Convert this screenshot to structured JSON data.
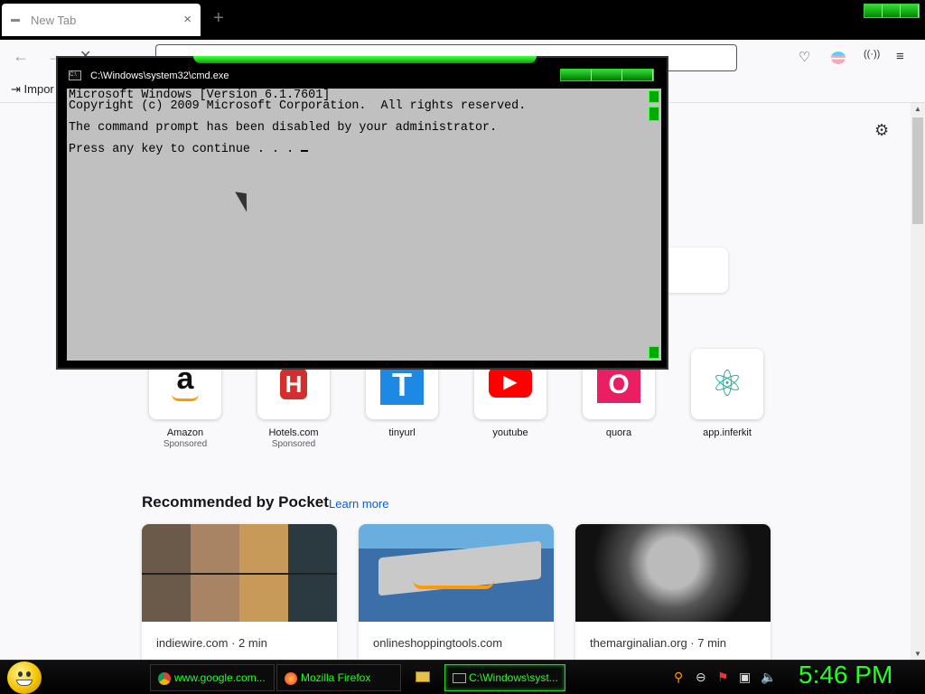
{
  "browser": {
    "tab_title": "New Tab",
    "tab_close": "×",
    "new_tab": "+",
    "back": "←",
    "forward": "→",
    "stop": "✕",
    "bookmark_import": "Impor",
    "settings_icon": "gear-icon"
  },
  "shortcuts": [
    {
      "name": "Amazon",
      "sponsored": "Sponsored",
      "glyph": "a",
      "color": "#ffffff"
    },
    {
      "name": "Hotels.com",
      "sponsored": "Sponsored",
      "glyph": "H",
      "color": "#d32f2f"
    },
    {
      "name": "tinyurl",
      "sponsored": "",
      "glyph": "T",
      "color": "#1e88e5"
    },
    {
      "name": "youtube",
      "sponsored": "",
      "glyph": "▶",
      "color": "#ff0000"
    },
    {
      "name": "quora",
      "sponsored": "",
      "glyph": "O",
      "color": "#e91e63"
    },
    {
      "name": "app.inferkit",
      "sponsored": "",
      "glyph": "⚛",
      "color": "#26a69a"
    }
  ],
  "pocket": {
    "heading": "Recommended by Pocket",
    "learn_more": "Learn more",
    "cards": [
      {
        "source": "indiewire.com · 2 min"
      },
      {
        "source": "onlineshoppingtools.com"
      },
      {
        "source": "themarginalian.org · 7 min"
      }
    ]
  },
  "cmd": {
    "title": "C:\\Windows\\system32\\cmd.exe",
    "icon_text": "C:\\",
    "line1": "Microsoft Windows [Version 6.1.7601]",
    "line2": "Copyright (c) 2009 Microsoft Corporation.  All rights reserved.",
    "line3": "The command prompt has been disabled by your administrator.",
    "line4": "Press any key to continue . . . "
  },
  "taskbar": {
    "items": [
      {
        "label": "www.google.com..."
      },
      {
        "label": "Mozilla Firefox"
      },
      {
        "label": "C:\\Windows\\syst..."
      }
    ],
    "clock": "5:46 PM"
  },
  "colors": {
    "accent_green": "#22ff22",
    "link_blue": "#0061e0"
  }
}
